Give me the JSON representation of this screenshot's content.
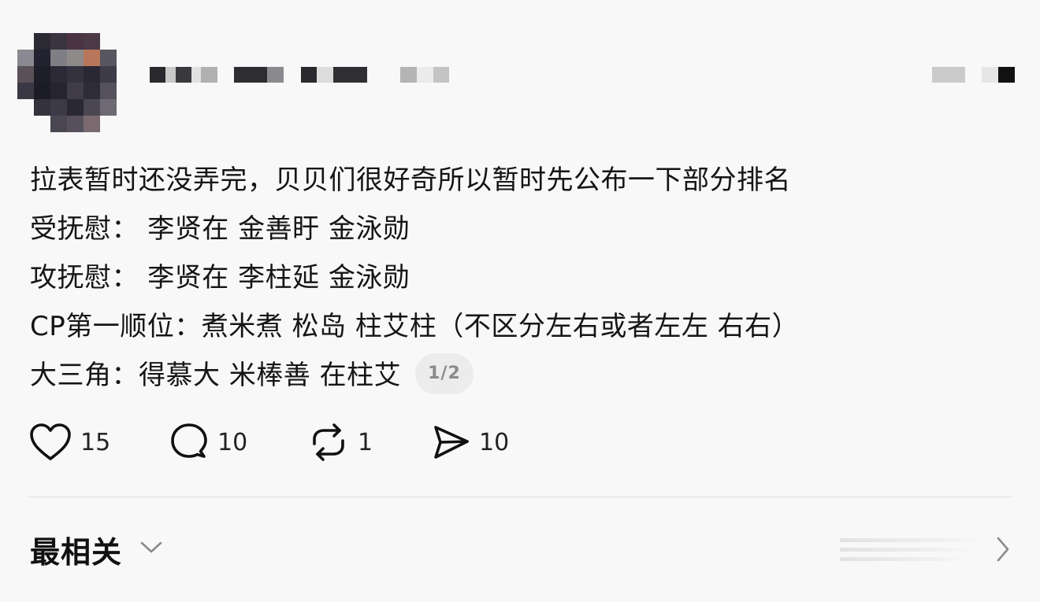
{
  "post": {
    "lines": [
      "拉表暂时还没弄完，贝贝们很好奇所以暂时先公布一下部分排名",
      "受抚慰： 李贤在 金善盱 金泳勋",
      "攻抚慰： 李贤在 李柱延 金泳勋",
      "CP第一顺位：煮米煮 松岛 柱艾柱（不区分左右或者左左 右右）",
      "大三角：得慕大 米棒善 在柱艾"
    ],
    "page_indicator": "1/2"
  },
  "actions": {
    "like_count": "15",
    "comment_count": "10",
    "repost_count": "1",
    "share_count": "10"
  },
  "footer": {
    "sort_label": "最相关"
  },
  "colors": {
    "background": "#f8f8f8",
    "text": "#111111",
    "pill_bg": "#ececec",
    "muted": "#8a8a8a",
    "divider": "#dcdcdc"
  },
  "icons": [
    "heart-icon",
    "comment-bubble-icon",
    "repost-icon",
    "share-send-icon",
    "chevron-down-icon",
    "chevron-right-icon"
  ]
}
